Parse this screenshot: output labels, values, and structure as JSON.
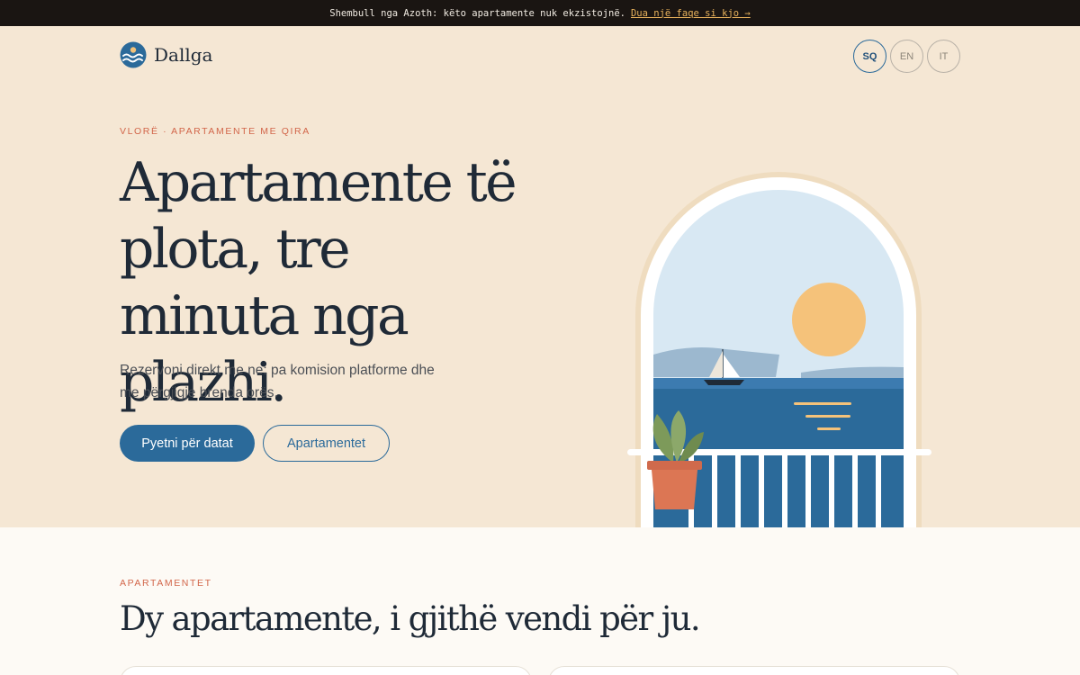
{
  "banner": {
    "message": "Shembull nga Azoth: këto apartamente nuk ekzistojnë.",
    "link_label": "Dua një faqe si kjo →"
  },
  "header": {
    "brand": "Dallga",
    "languages": [
      {
        "code": "SQ",
        "active": true
      },
      {
        "code": "EN",
        "active": false
      },
      {
        "code": "IT",
        "active": false
      }
    ]
  },
  "hero": {
    "eyebrow": "VLORË · APARTAMENTE ME QIRA",
    "title": "Apartamente të plota, tre minuta nga plazhi.",
    "text": "Rezervoni direkt me ne: pa komision platforme dhe me përgjigje brenda orës.",
    "primary_button": "Pyetni për datat",
    "secondary_button": "Apartamentet"
  },
  "apartments": {
    "eyebrow": "APARTAMENTET",
    "title": "Dy apartamente, i gjithë vendi për ju."
  },
  "colors": {
    "accent": "#2b6a9a",
    "eyebrow": "#d2664a",
    "hero_bg": "#f5e7d4",
    "section_bg": "#fdfaf5"
  }
}
